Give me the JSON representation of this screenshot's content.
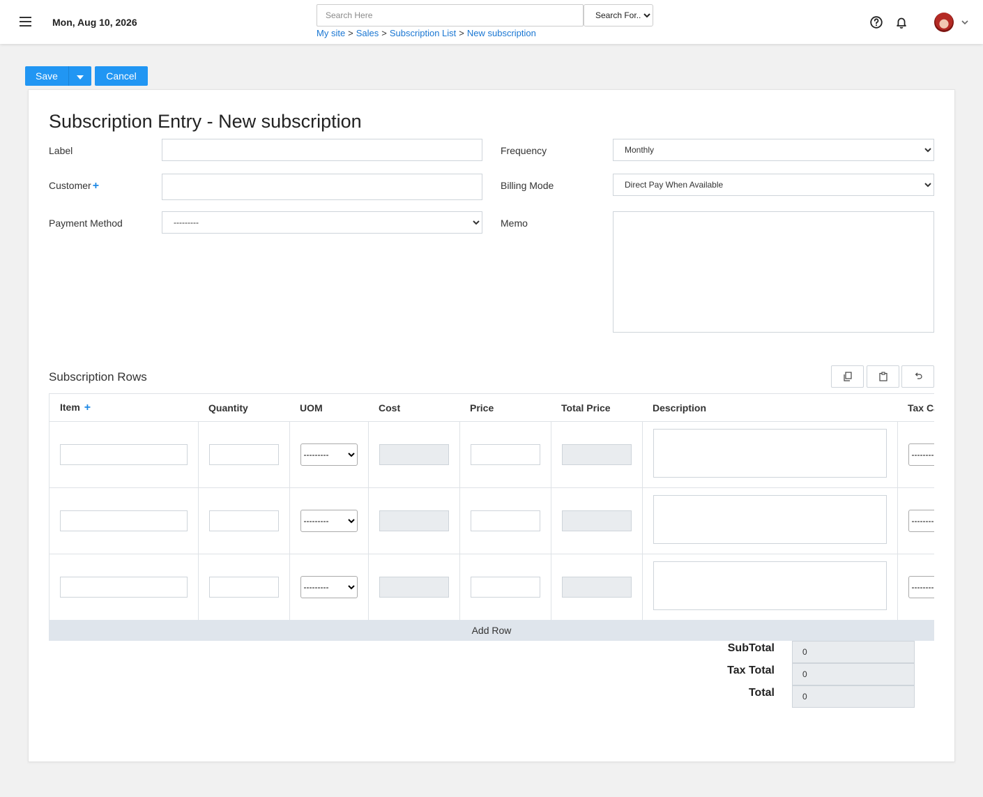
{
  "header": {
    "date": "Mon, Aug 10, 2026",
    "search_placeholder": "Search Here",
    "search_scope": "Search For...",
    "breadcrumb": [
      "My site",
      "Sales",
      "Subscription List",
      "New subscription"
    ]
  },
  "actions": {
    "save": "Save",
    "cancel": "Cancel"
  },
  "form": {
    "title": "Subscription Entry - New subscription",
    "label_label": "Label",
    "customer_label": "Customer",
    "payment_method_label": "Payment Method",
    "payment_method_value": "---------",
    "frequency_label": "Frequency",
    "frequency_value": "Monthly",
    "billing_mode_label": "Billing Mode",
    "billing_mode_value": "Direct Pay When Available",
    "memo_label": "Memo"
  },
  "rows_section": {
    "title": "Subscription Rows",
    "columns": [
      "Item",
      "Quantity",
      "UOM",
      "Cost",
      "Price",
      "Total Price",
      "Description",
      "Tax Ca"
    ],
    "uom_value": "---------",
    "tax_value": "---------",
    "add_row": "Add Row"
  },
  "totals": {
    "subtotal_label": "SubTotal",
    "subtotal": "0",
    "tax_label": "Tax Total",
    "tax": "0",
    "total_label": "Total",
    "total": "0"
  },
  "colors": {
    "accent": "#2196f3",
    "link": "#1976d2",
    "add_row_bg": "#dfe5ec"
  }
}
